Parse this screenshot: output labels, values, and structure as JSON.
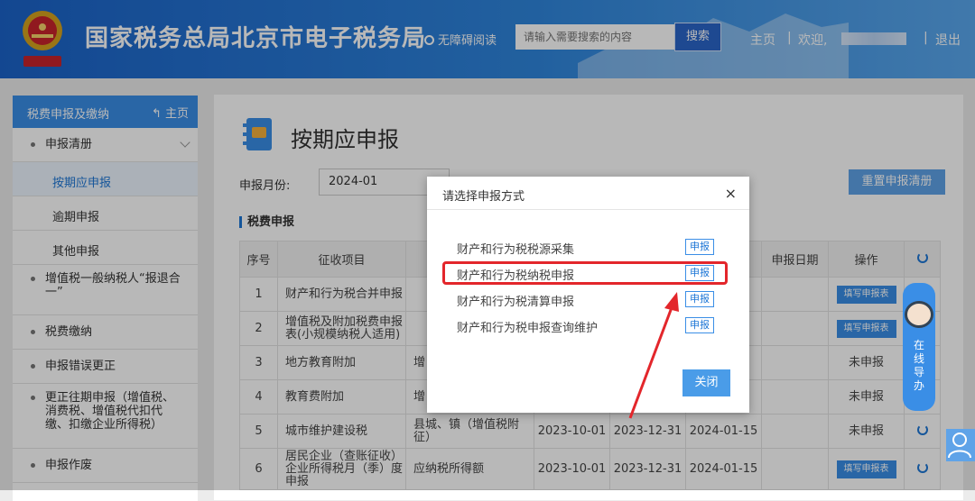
{
  "header": {
    "site_title": "国家税务总局北京市电子税务局",
    "accessibility_label": "无障碍阅读",
    "search_placeholder": "请输入需要搜索的内容",
    "search_button": "搜索",
    "home_link": "主页",
    "separator": "|",
    "welcome": "欢迎,",
    "logout": "退出"
  },
  "sidebar": {
    "header_title": "税费申报及缴纳",
    "header_home": "主页",
    "items": [
      {
        "label": "申报清册"
      },
      {
        "label": "按期应申报"
      },
      {
        "label": "逾期申报"
      },
      {
        "label": "其他申报"
      },
      {
        "label": "增值税一般纳税人“报退合一”"
      },
      {
        "label": "税费缴纳"
      },
      {
        "label": "申报错误更正"
      },
      {
        "label": "更正往期申报（增值税、消费税、增值税代扣代缴、扣缴企业所得税）"
      },
      {
        "label": "申报作废"
      }
    ]
  },
  "main": {
    "page_title": "按期应申报",
    "period_label": "申报月份:",
    "period_value": "2024-01",
    "reset_button": "重置申报清册",
    "section_title": "税费申报",
    "table": {
      "headers": [
        "序号",
        "征收项目",
        "",
        "",
        "",
        "",
        "申报日期",
        "操作",
        ""
      ],
      "rows": [
        {
          "no": "1",
          "item": "财产和行为税合并申报",
          "c3": "",
          "c4": "",
          "c5": "",
          "c6": "",
          "date": "",
          "op": "填写申报表"
        },
        {
          "no": "2",
          "item": "增值税及附加税费申报表(小规模纳税人适用)",
          "c3": "",
          "c4": "",
          "c5": "",
          "c6": "",
          "date": "",
          "op": "填写申报表"
        },
        {
          "no": "3",
          "item": "地方教育附加",
          "c3": "增",
          "c4": "",
          "c5": "",
          "c6": "",
          "date": "",
          "op": "未申报"
        },
        {
          "no": "4",
          "item": "教育费附加",
          "c3": "增",
          "c4": "",
          "c5": "",
          "c6": "",
          "date": "",
          "op": "未申报"
        },
        {
          "no": "5",
          "item": "城市维护建设税",
          "c3": "县城、镇（增值税附征）",
          "c4": "2023-10-01",
          "c5": "2023-12-31",
          "c6": "2024-01-15",
          "date": "",
          "op": "未申报"
        },
        {
          "no": "6",
          "item": "居民企业（查账征收）企业所得税月（季）度申报",
          "c3": "应纳税所得额",
          "c4": "2023-10-01",
          "c5": "2023-12-31",
          "c6": "2024-01-15",
          "date": "",
          "op": "填写申报表"
        }
      ]
    }
  },
  "modal": {
    "title": "请选择申报方式",
    "close_icon": "×",
    "options": [
      {
        "label": "财产和行为税税源采集",
        "button": "申报"
      },
      {
        "label": "财产和行为税纳税申报",
        "button": "申报"
      },
      {
        "label": "财产和行为税清算申报",
        "button": "申报"
      },
      {
        "label": "财产和行为税申报查询维护",
        "button": "申报"
      }
    ],
    "close_button": "关闭"
  },
  "widgets": {
    "online_guide": "在线导办"
  },
  "colors": {
    "header_blue": "#1b63c9",
    "accent": "#3a8ee6",
    "highlight_red": "#e3262b"
  }
}
